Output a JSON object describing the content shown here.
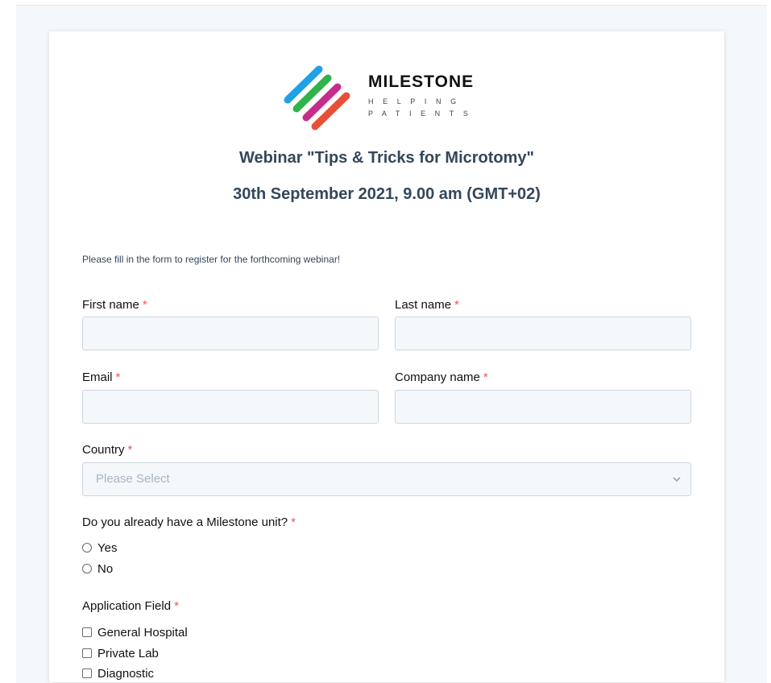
{
  "brand": {
    "name": "MILESTONE",
    "tagline_line1": "HELPING",
    "tagline_line2": "PATIENTS",
    "logo_icon": "diagonal-color-stripes-icon",
    "stripe_colors": [
      "#1ea1e5",
      "#2fb34a",
      "#c62c8c",
      "#e94e36"
    ]
  },
  "header": {
    "title": "Webinar \"Tips & Tricks for Microtomy\"",
    "subtitle": "30th September 2021, 9.00 am (GMT+02)"
  },
  "intro": "Please fill in the form to register for the forthcoming webinar!",
  "required_marker": "*",
  "fields": {
    "first_name": {
      "label": "First name",
      "value": ""
    },
    "last_name": {
      "label": "Last name",
      "value": ""
    },
    "email": {
      "label": "Email",
      "value": ""
    },
    "company_name": {
      "label": "Company name",
      "value": ""
    },
    "country": {
      "label": "Country",
      "placeholder": "Please Select",
      "selected": ""
    }
  },
  "milestone_unit": {
    "question": "Do you already have a Milestone unit?",
    "options": [
      "Yes",
      "No"
    ]
  },
  "application_field": {
    "label": "Application Field",
    "options": [
      "General Hospital",
      "Private Lab",
      "Diagnostic"
    ]
  },
  "colors": {
    "heading": "#33475b",
    "required": "#f2545b",
    "input_bg": "#f5f8fa",
    "input_border": "#cbd6e2"
  }
}
